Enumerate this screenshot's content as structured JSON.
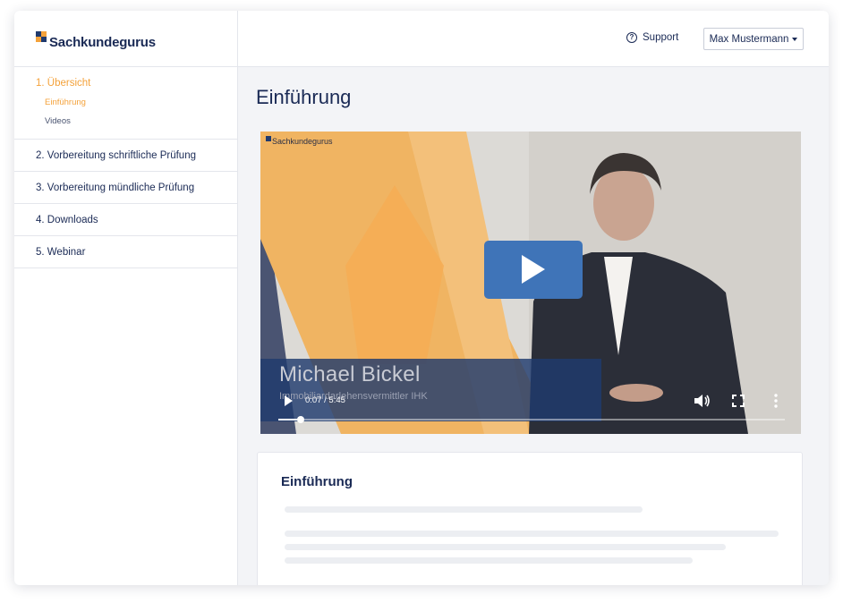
{
  "brand": {
    "name": "Sachkundegurus",
    "colors": {
      "navy": "#1a2a55",
      "orange": "#f4a23b",
      "blue": "#3f74b8"
    }
  },
  "sidebar": {
    "sections": [
      {
        "label": "1. Übersicht",
        "active": true,
        "children": [
          {
            "label": "Einführung",
            "active": true
          },
          {
            "label": "Videos",
            "active": false
          }
        ]
      },
      {
        "label": "2. Vorbereitung schriftliche Prüfung"
      },
      {
        "label": "3. Vorbereitung mündliche Prüfung"
      },
      {
        "label": "4. Downloads"
      },
      {
        "label": "5. Webinar"
      }
    ]
  },
  "header": {
    "support_label": "Support",
    "support_icon": "question-circle-icon",
    "user_name": "Max Mustermann"
  },
  "main": {
    "title": "Einführung",
    "video": {
      "logo_text": "Sachkundegurus",
      "speaker_name": "Michael Bickel",
      "speaker_subtitle": "Immobiliardarlehensvermittler IHK",
      "time": "0:07 / 5:45",
      "progress_percent": 2
    },
    "card": {
      "title": "Einführung"
    }
  }
}
